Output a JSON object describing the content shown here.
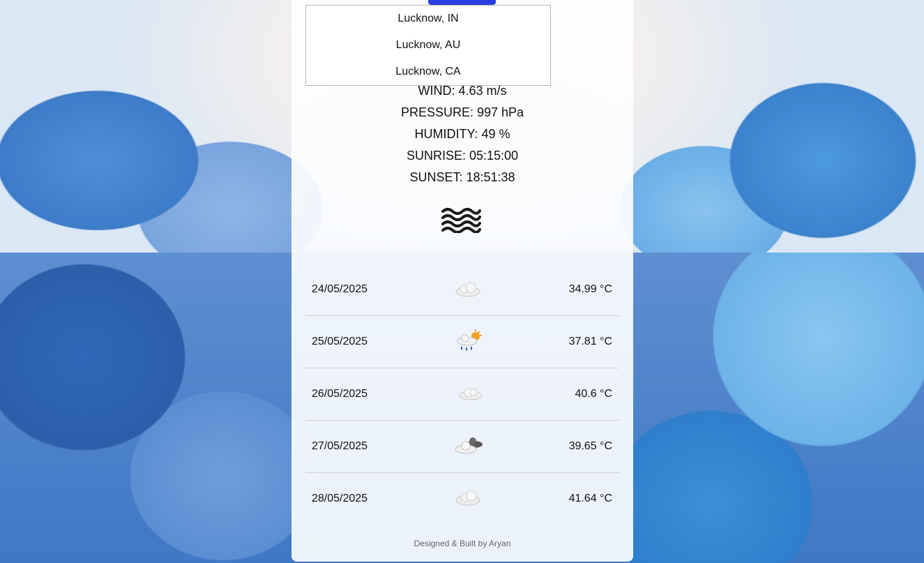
{
  "search": {
    "button_color": "#2a3fe0"
  },
  "suggestions": [
    "Lucknow, IN",
    "Lucknow, AU",
    "Lucknow, CA"
  ],
  "details": {
    "wind": "WIND: 4.63 m/s",
    "pressure": "PRESSURE: 997 hPa",
    "humidity": "HUMIDITY: 49 %",
    "sunrise": "SUNRISE: 05:15:00",
    "sunset": "SUNSET: 18:51:38",
    "icon": "wind-haze-icon"
  },
  "forecast": [
    {
      "date": "24/05/2025",
      "temp": "34.99 °C",
      "icon": "cloud-icon"
    },
    {
      "date": "25/05/2025",
      "temp": "37.81 °C",
      "icon": "rain-sun-icon"
    },
    {
      "date": "26/05/2025",
      "temp": "40.6 °C",
      "icon": "cloud-icon"
    },
    {
      "date": "27/05/2025",
      "temp": "39.65 °C",
      "icon": "dark-clouds-icon"
    },
    {
      "date": "28/05/2025",
      "temp": "41.64 °C",
      "icon": "cloud-icon"
    }
  ],
  "footer": "Designed & Built by Aryan"
}
